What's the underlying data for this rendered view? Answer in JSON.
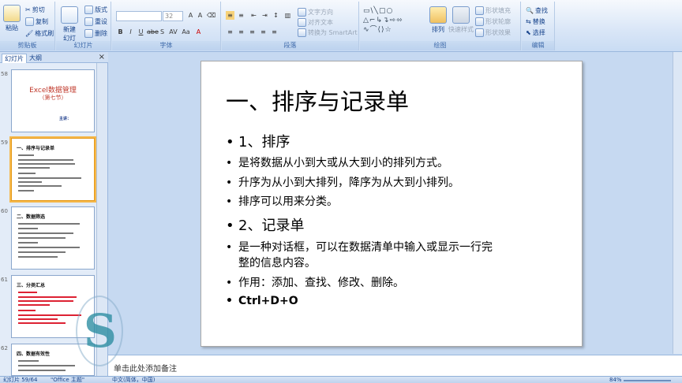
{
  "ribbon": {
    "clipboard": {
      "paste": "粘贴",
      "cut": "剪切",
      "copy": "复制",
      "format_painter": "格式刷",
      "label": "剪贴板"
    },
    "slides": {
      "new_slide": "新建幻灯片",
      "layout": "版式",
      "reset": "重设",
      "delete": "删除",
      "label": "幻灯片"
    },
    "font": {
      "font_size": "32",
      "label": "字体"
    },
    "paragraph": {
      "text_direction": "文字方向",
      "align_text": "对齐文本",
      "smartart": "转换为 SmartArt",
      "label": "段落"
    },
    "drawing": {
      "arrange": "排列",
      "quick_styles": "快速样式",
      "shape_fill": "形状填充",
      "shape_outline": "形状轮廓",
      "shape_effects": "形状效果",
      "label": "绘图"
    },
    "editing": {
      "find": "查找",
      "replace": "替换",
      "select": "选择",
      "label": "编辑"
    }
  },
  "panel": {
    "tab_slides": "幻灯片",
    "tab_outline": "大纲",
    "close": "×",
    "thumbnails": [
      {
        "number": "58",
        "title": "Excel数据管理",
        "subtitle": "（第七节）",
        "author": "主讲：",
        "selected": false
      },
      {
        "number": "59",
        "title": "一、排序与记录单",
        "selected": true
      },
      {
        "number": "60",
        "title": "二、数据筛选",
        "selected": false
      },
      {
        "number": "61",
        "title": "三、分类汇总",
        "selected": false
      },
      {
        "number": "62",
        "title": "四、数据有效性",
        "selected": false
      }
    ]
  },
  "slide": {
    "title": "一、排序与记录单",
    "bullets": [
      {
        "text": "1、排序",
        "style": "big"
      },
      {
        "text": "是将数据从小到大或从大到小的排列方式。",
        "style": "small"
      },
      {
        "text": "升序为从小到大排列，降序为从大到小排列。",
        "style": "small"
      },
      {
        "text": "排序可以用来分类。",
        "style": "small"
      },
      {
        "text": "2、记录单",
        "style": "big"
      },
      {
        "text": "是一种对话框，可以在数据清单中输入或显示一行完",
        "style": "small"
      },
      {
        "text": "整的信息内容。",
        "style": "cont"
      },
      {
        "text": "作用：添加、查找、修改、删除。",
        "style": "small"
      },
      {
        "text": "Ctrl+D+O",
        "style": "bold"
      }
    ]
  },
  "notes": {
    "placeholder": "单击此处添加备注"
  },
  "status": {
    "slide_count": "幻灯片 59/64",
    "theme": "\"Office 主题\"",
    "language": "中文(简体，中国)",
    "zoom": "84%"
  }
}
